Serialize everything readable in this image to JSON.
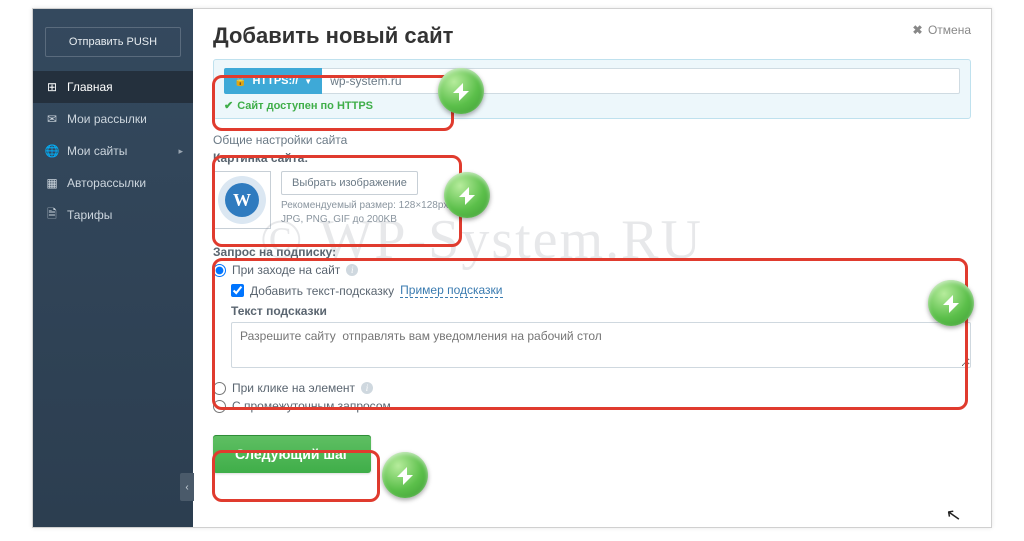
{
  "sidebar": {
    "push_label": "Отправить PUSH",
    "items": [
      {
        "label": "Главная",
        "icon": "⊞"
      },
      {
        "label": "Мои рассылки",
        "icon": "✉"
      },
      {
        "label": "Мои сайты",
        "icon": "🌐"
      },
      {
        "label": "Авторассылки",
        "icon": "▦"
      },
      {
        "label": "Тарифы",
        "icon": "🗎"
      }
    ]
  },
  "header": {
    "title": "Добавить новый сайт",
    "cancel": "Отмена"
  },
  "url_panel": {
    "protocol_label": "HTTPS://",
    "domain": "wp-system.ru",
    "https_ok": "Сайт доступен по HTTPS"
  },
  "general": {
    "section_title": "Общие настройки сайта",
    "image_label": "Картинка сайта:",
    "choose_btn": "Выбрать изображение",
    "size_hint_1": "Рекомендуемый размер: 128×128px",
    "size_hint_2": "JPG, PNG, GIF до 200KB"
  },
  "subscribe": {
    "section_title": "Запрос на подписку:",
    "opt_visit": "При заходе на сайт",
    "add_hint_cb": "Добавить текст-подсказку",
    "example_link": "Пример подсказки",
    "hint_label": "Текст подсказки",
    "hint_placeholder": "Разрешите сайту  отправлять вам уведомления на рабочий стол",
    "opt_click": "При клике на элемент",
    "opt_inter": "С промежуточным запросом"
  },
  "actions": {
    "next": "Следующий шаг"
  },
  "watermark": "© WP-System.RU"
}
